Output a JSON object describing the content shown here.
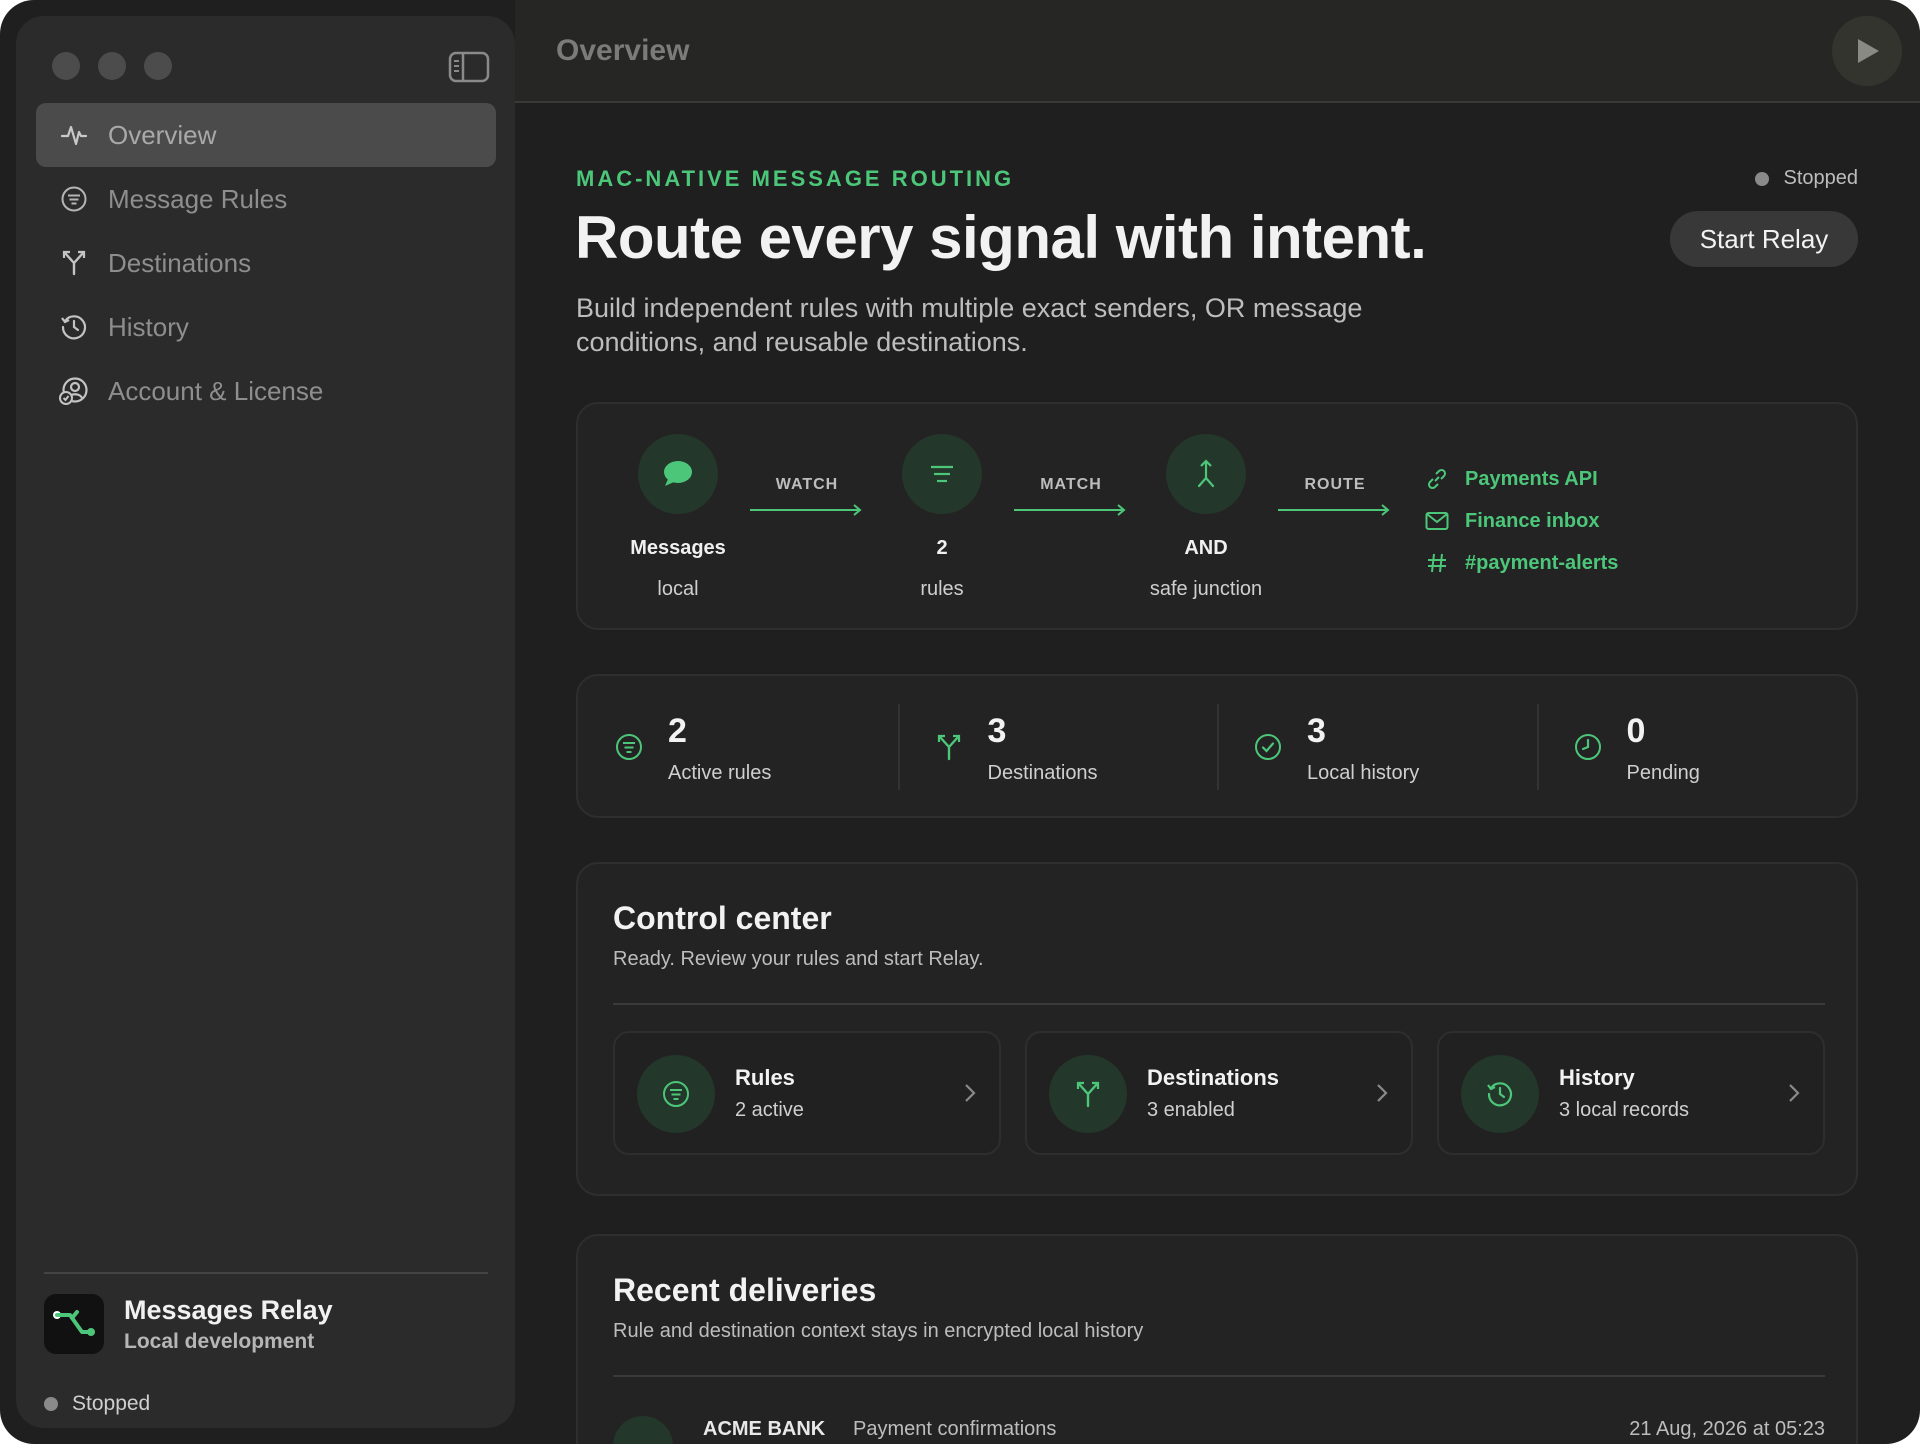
{
  "sidebar": {
    "items": [
      {
        "label": "Overview",
        "icon": "pulse-icon",
        "active": true
      },
      {
        "label": "Message Rules",
        "icon": "rules-icon",
        "active": false
      },
      {
        "label": "Destinations",
        "icon": "fork-icon",
        "active": false
      },
      {
        "label": "History",
        "icon": "history-icon",
        "active": false
      },
      {
        "label": "Account & License",
        "icon": "account-icon",
        "active": false
      }
    ],
    "app_name": "Messages Relay",
    "app_sub": "Local development",
    "status": "Stopped"
  },
  "topbar": {
    "title": "Overview"
  },
  "hero": {
    "eyebrow": "MAC-NATIVE MESSAGE ROUTING",
    "title": "Route every signal with intent.",
    "subtitle": "Build independent rules with multiple exact senders, OR message conditions, and reusable destinations.",
    "status": "Stopped",
    "start_label": "Start Relay"
  },
  "flow": {
    "nodes": [
      {
        "title": "Messages",
        "sub": "local",
        "icon": "chat-bubble-icon"
      },
      {
        "title": "2",
        "sub": "rules",
        "icon": "filter-lines-icon"
      },
      {
        "title": "AND",
        "sub": "safe junction",
        "icon": "merge-arrow-icon"
      }
    ],
    "edges": [
      "WATCH",
      "MATCH",
      "ROUTE"
    ],
    "destinations": [
      {
        "label": "Payments API",
        "icon": "link-icon"
      },
      {
        "label": "Finance inbox",
        "icon": "mail-icon"
      },
      {
        "label": "#payment-alerts",
        "icon": "hash-icon"
      }
    ]
  },
  "stats": [
    {
      "value": "2",
      "label": "Active rules",
      "icon": "rules-icon"
    },
    {
      "value": "3",
      "label": "Destinations",
      "icon": "fork-icon"
    },
    {
      "value": "3",
      "label": "Local history",
      "icon": "check-circle-icon"
    },
    {
      "value": "0",
      "label": "Pending",
      "icon": "clock-icon"
    }
  ],
  "control": {
    "title": "Control center",
    "subtitle": "Ready. Review your rules and start Relay.",
    "tiles": [
      {
        "title": "Rules",
        "sub": "2 active",
        "icon": "rules-icon"
      },
      {
        "title": "Destinations",
        "sub": "3 enabled",
        "icon": "fork-icon"
      },
      {
        "title": "History",
        "sub": "3 local records",
        "icon": "history-icon"
      }
    ]
  },
  "recent": {
    "title": "Recent deliveries",
    "subtitle": "Rule and destination context stays in encrypted local history",
    "rows": [
      {
        "sender": "ACME BANK",
        "rule": "Payment confirmations",
        "time": "21 Aug, 2026 at 05:23"
      }
    ]
  },
  "colors": {
    "accent": "#4cc77a",
    "background": "#1f1f1f",
    "sidebar": "#2b2b2b",
    "icon_bg": "#24372b"
  }
}
